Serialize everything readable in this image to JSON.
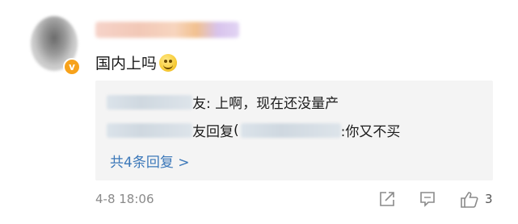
{
  "comment": {
    "text": "国内上吗",
    "emoji": "smile-emoji"
  },
  "replies": [
    {
      "suffix": "友: 上啊，现在还没量产"
    },
    {
      "mid": "友回复",
      "paren": "(",
      "suffix": ":你又不买"
    }
  ],
  "reply_count": "共4条回复 >",
  "footer": {
    "timestamp": "4-8 18:06",
    "like_count": "3"
  },
  "colors": {
    "link": "#3c78b9",
    "badge": "#f7a21b",
    "reply_bg": "#f4f4f4"
  }
}
